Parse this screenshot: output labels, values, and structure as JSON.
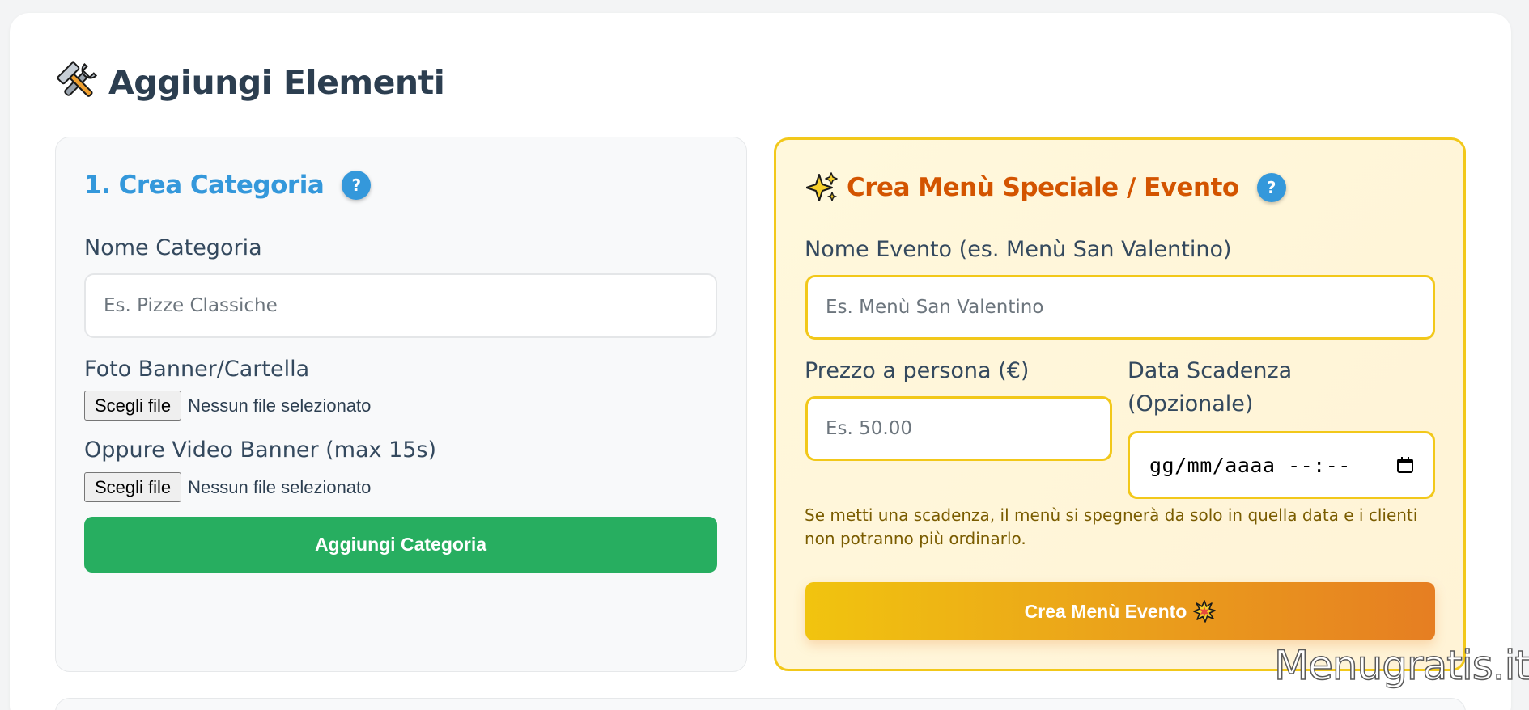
{
  "page": {
    "title": "Aggiungi Elementi",
    "title_icon": "hammer-and-wrench-icon"
  },
  "category_panel": {
    "heading": "1. Crea Categoria",
    "heading_color": "#3498db",
    "help_label": "?",
    "name_label": "Nome Categoria",
    "name_placeholder": "Es. Pizze Classiche",
    "banner_label": "Foto Banner/Cartella",
    "video_label": "Oppure Video Banner (max 15s)",
    "file_button_label": "Scegli file",
    "file_status": "Nessun file selezionato",
    "submit_label": "Aggiungi Categoria",
    "submit_color": "#27ae60"
  },
  "event_panel": {
    "heading": "Crea Menù Speciale / Evento",
    "heading_icon": "sparkles-icon",
    "heading_color": "#d35400",
    "help_label": "?",
    "name_label": "Nome Evento (es. Menù San Valentino)",
    "name_placeholder": "Es. Menù San Valentino",
    "price_label": "Prezzo a persona (€)",
    "price_placeholder": "Es. 50.00",
    "date_label_line1": "Data Scadenza",
    "date_label_line2": "(Opzionale)",
    "date_value": "gg/mm/aaaa --:--",
    "hint": "Se metti una scadenza, il menù si spegnerà da solo in quella data e i clienti non potranno più ordinarlo.",
    "submit_label": "Crea Menù Evento",
    "submit_icon": "collision-icon",
    "accent_color": "#f2c81a"
  },
  "watermark": "Menugratis.it"
}
